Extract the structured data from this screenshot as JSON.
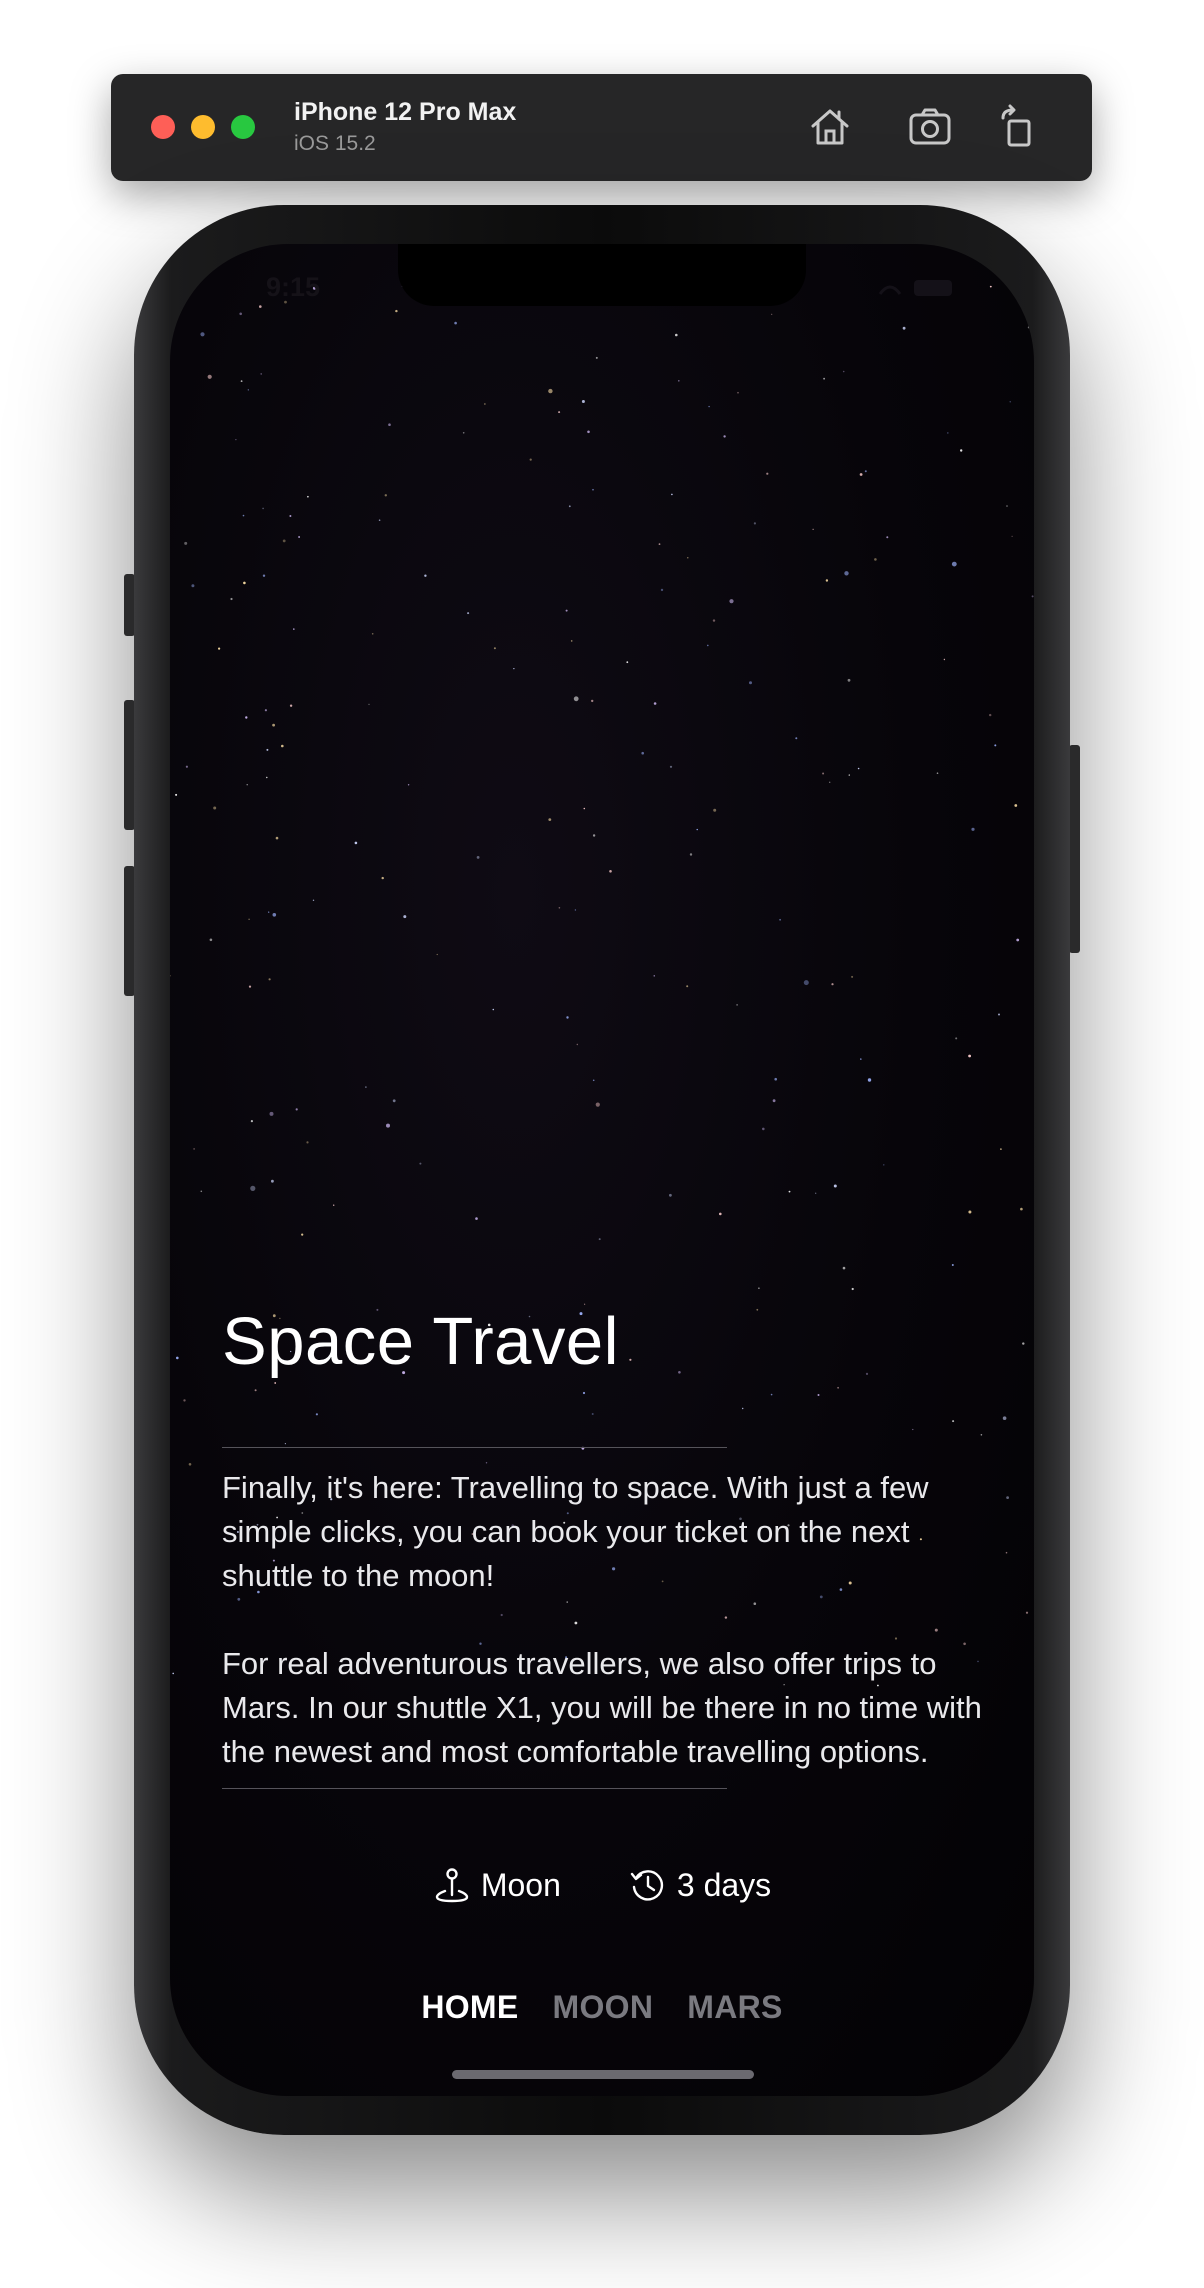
{
  "simulator": {
    "device_name": "iPhone 12 Pro Max",
    "os_version": "iOS 15.2",
    "icons": [
      "home-icon",
      "screenshot-icon",
      "rotate-icon"
    ]
  },
  "status_bar": {
    "time": "9:15"
  },
  "main": {
    "title": "Space Travel",
    "paragraphs": [
      "Finally, it's here: Travelling to space. With just a few simple clicks, you can book your ticket on the next shuttle to the moon!",
      "For real adventurous travellers, we also offer trips to Mars. In our shuttle X1, you will be there in no time with the newest and most comfortable travelling options."
    ],
    "info": {
      "destination": {
        "icon": "location-pin-icon",
        "label": "Moon"
      },
      "duration": {
        "icon": "history-clock-icon",
        "label": "3 days"
      }
    }
  },
  "tabs": [
    {
      "label": "HOME",
      "active": true
    },
    {
      "label": "MOON",
      "active": false
    },
    {
      "label": "MARS",
      "active": false
    }
  ],
  "colors": {
    "background": "#060409",
    "text": "#ffffff",
    "inactive_tab": "#7a7a80",
    "divider": "#55535a"
  }
}
